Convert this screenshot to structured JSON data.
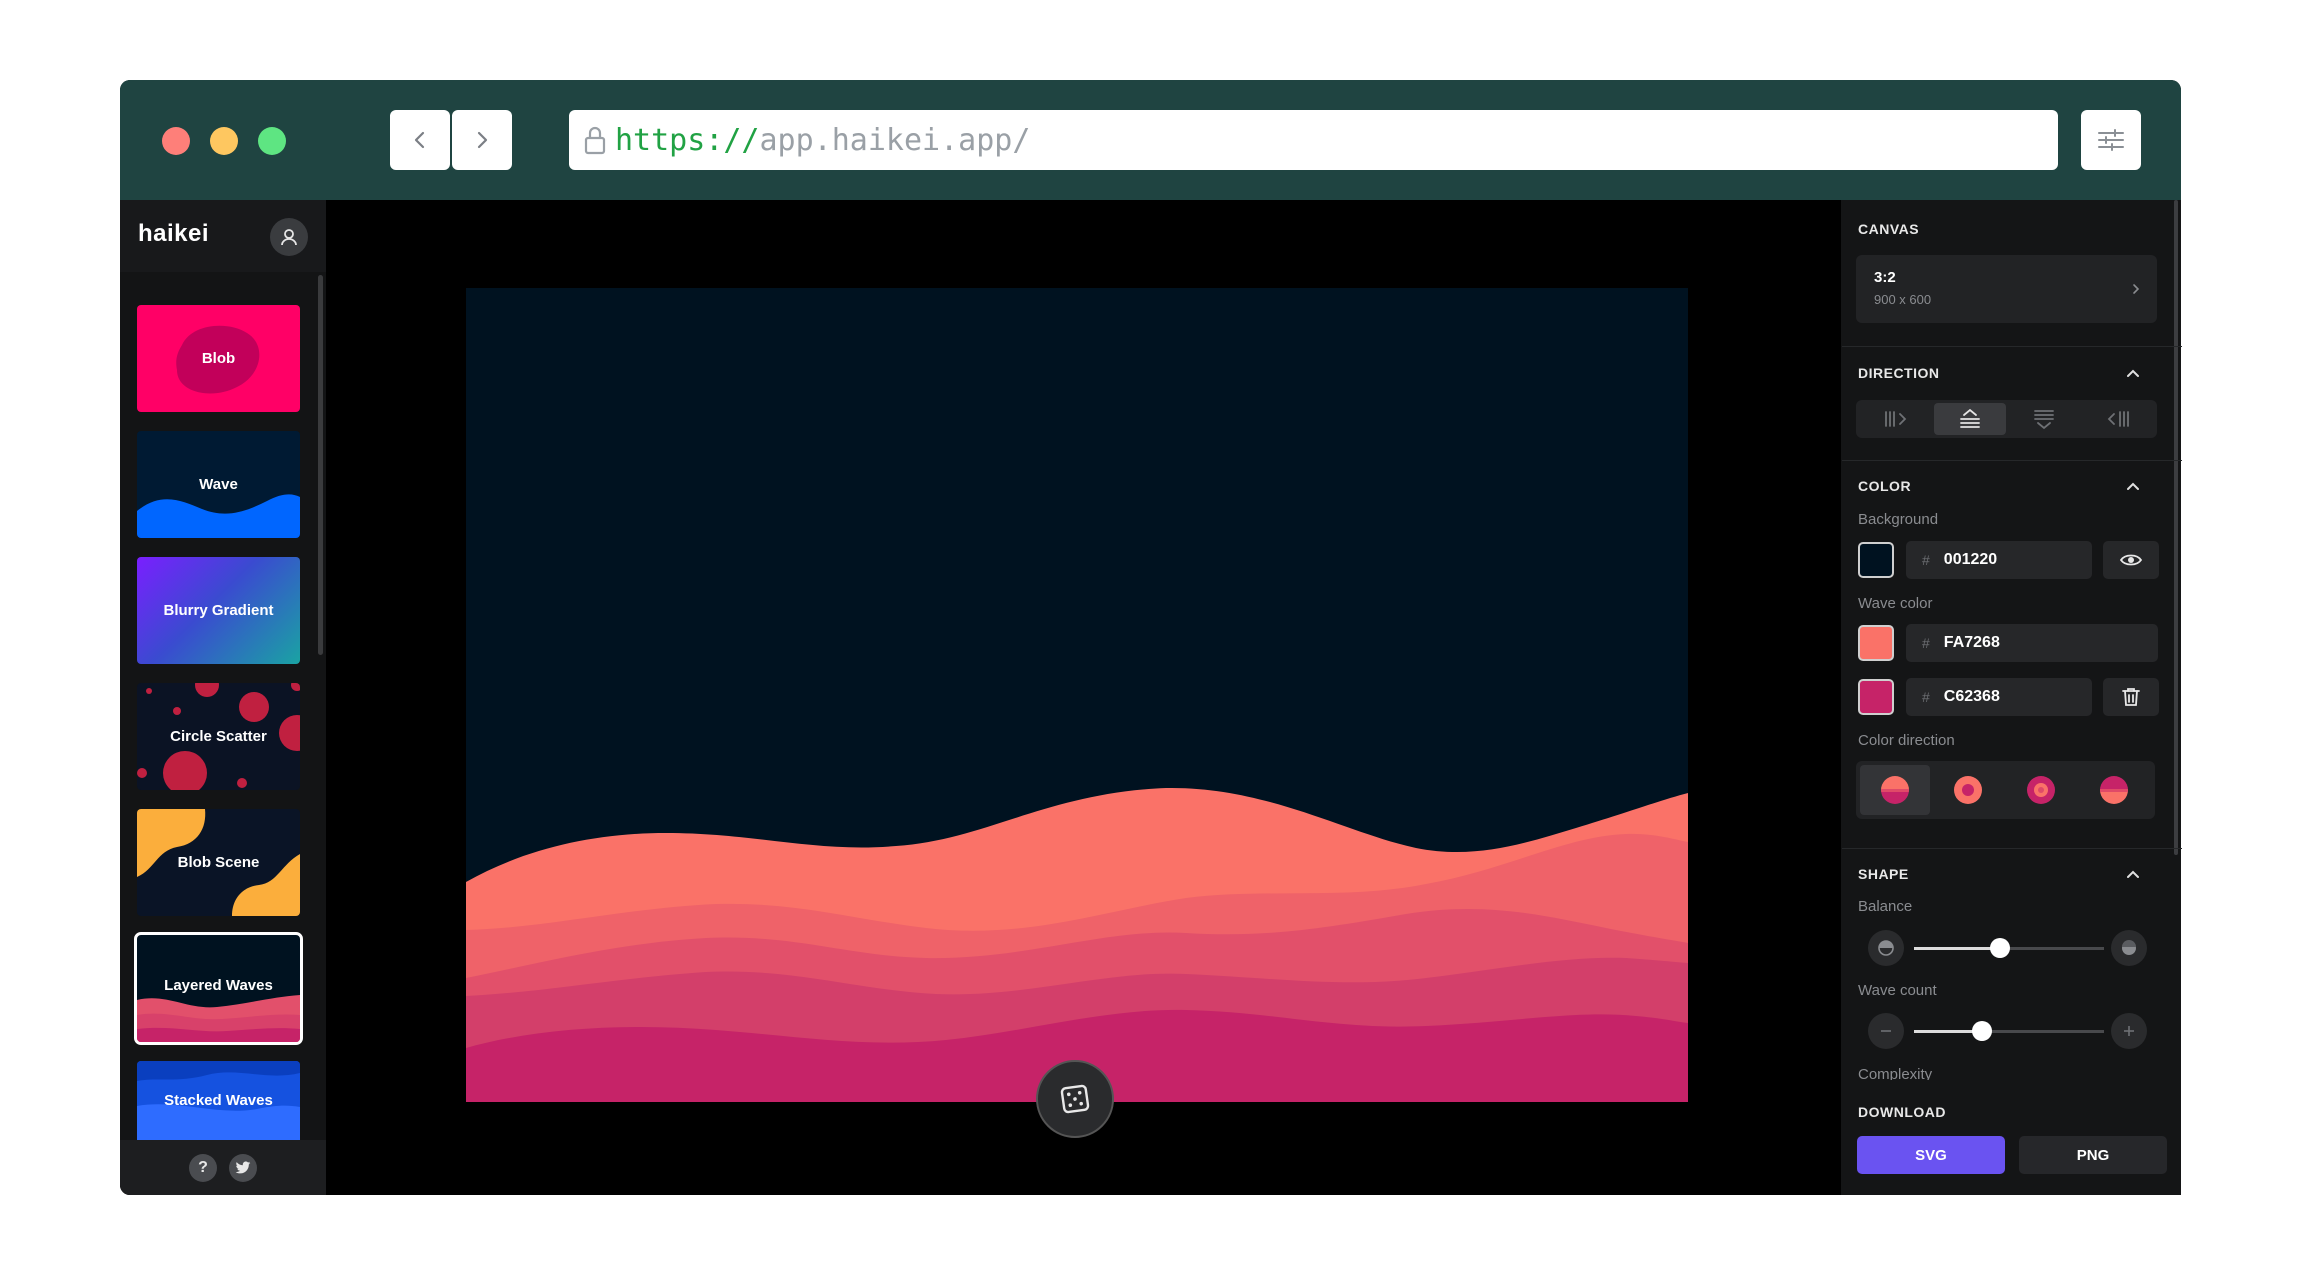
{
  "browser": {
    "url_scheme": "https://",
    "url_host": "app.haikei.app/"
  },
  "sidebar": {
    "logo": "haikei",
    "items": [
      {
        "label": "Blob"
      },
      {
        "label": "Wave"
      },
      {
        "label": "Blurry Gradient"
      },
      {
        "label": "Circle Scatter"
      },
      {
        "label": "Blob Scene"
      },
      {
        "label": "Layered Waves",
        "selected": true
      },
      {
        "label": "Stacked Waves"
      }
    ],
    "footer": {
      "help": "?"
    }
  },
  "panel": {
    "canvas": {
      "heading": "CANVAS",
      "ratio": "3:2",
      "size": "900 x 600"
    },
    "direction": {
      "heading": "DIRECTION",
      "selected_index": 1
    },
    "color": {
      "heading": "COLOR",
      "background_label": "Background",
      "background_hex": "001220",
      "background_color": "#001220",
      "wave_label": "Wave color",
      "wave_colors": [
        {
          "hex": "FA7268",
          "color": "#FA7268"
        },
        {
          "hex": "C62368",
          "color": "#C62368"
        }
      ],
      "hash": "#",
      "direction_label": "Color direction",
      "direction_selected_index": 0
    },
    "shape": {
      "heading": "SHAPE",
      "balance_label": "Balance",
      "balance_value": 0.45,
      "wave_count_label": "Wave count",
      "wave_count_value": 0.36,
      "complexity_label": "Complexity"
    },
    "download": {
      "heading": "DOWNLOAD",
      "svg_label": "SVG",
      "png_label": "PNG",
      "svg_color": "#6a53f1",
      "png_color": "#26272a"
    }
  }
}
